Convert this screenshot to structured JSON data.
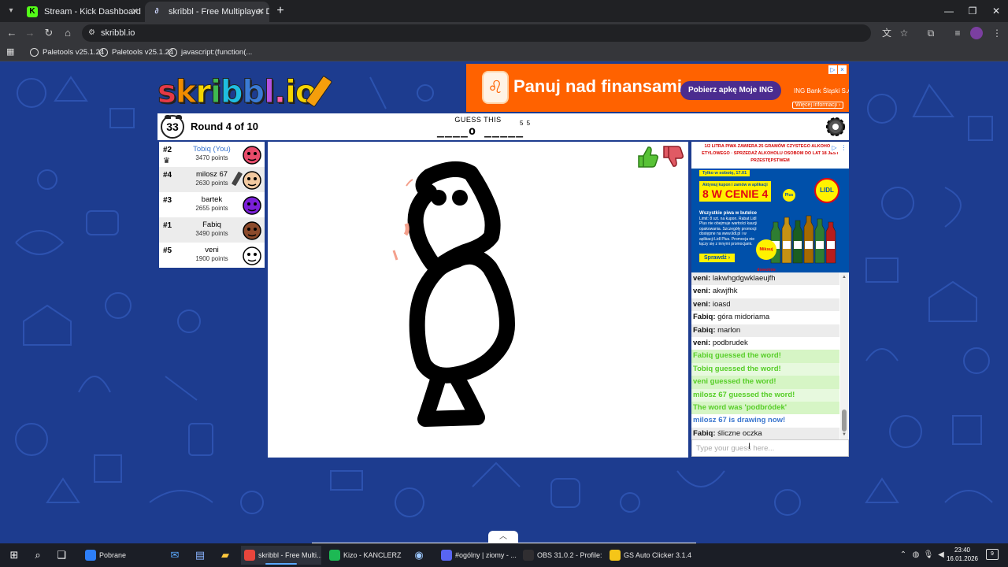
{
  "browser": {
    "tabs": [
      {
        "title": "Stream - Kick Dashboard"
      },
      {
        "title": "skribbl - Free Multiplayer Drawi"
      }
    ],
    "url": "skribbl.io",
    "bookmarks": [
      "Paletools v25.1.24",
      "Paletools v25.1.24",
      "javascript:(function(..."
    ]
  },
  "game": {
    "logo": {
      "s": "s",
      "k": "k",
      "r": "r",
      "i": "i",
      "b1": "b",
      "b2": "b",
      "l": "l",
      "dot": ".",
      "io": "io"
    },
    "timer": "33",
    "round": "Round 4 of 10",
    "guess_label": "GUESS THIS",
    "word_hint": "____o _____",
    "word_lengths": "5 5",
    "players": [
      {
        "rank": "#2",
        "name": "Tobiq (You)",
        "points": "3470 points",
        "is_you": true,
        "crown": true,
        "avatar_color": "#e74c6b"
      },
      {
        "rank": "#4",
        "name": "milosz 67",
        "points": "2630 points",
        "drawing": true,
        "avatar_color": "#f2c9a0"
      },
      {
        "rank": "#3",
        "name": "bartek",
        "points": "2655 points",
        "avatar_color": "#7b1fd8"
      },
      {
        "rank": "#1",
        "name": "Fabiq",
        "points": "3490 points",
        "avatar_color": "#8b4a2b"
      },
      {
        "rank": "#5",
        "name": "veni",
        "points": "1900 points",
        "avatar_color": "#ffffff"
      }
    ]
  },
  "ads": {
    "top": {
      "headline": "Panuj nad finansami",
      "cta": "Pobierz apkę Moje ING",
      "sponsor": "ING Bank Śląski S.A.",
      "more": "Więcej informacji ›"
    },
    "side": {
      "warning": "1/2 LITRA PIWA ZAWIERA 25 GRAMÓW CZYSTEGO ALKOHOLU ETYLOWEGO · SPRZEDAŻ ALKOHOLU OSOBOM DO LAT 18 JEST PRZESTĘPSTWEM",
      "date_badge": "Tylko w sobotę, 17.01",
      "promo_sub": "Aktywuj kupon i zamów w aplikacji",
      "promo_main": "8 W CENIE 4",
      "plus_label": "Plus",
      "lidl_label": "LIDL",
      "desc_title": "Wszystkie piwa w butelce",
      "desc_body": "Limit: 8 szt. na kupon. Rabat Lidl Plus nie obejmuje wartości kaucji opakowania. Szczegóły promocji dostępne na www.lidl.pl i w aplikacji Lidl Plus. Promocja nie łączy się z innymi promocjami.",
      "mix": "Miksuj dowolnie",
      "cta": "Sprawdź ›"
    }
  },
  "chat": {
    "messages": [
      {
        "author": "veni:",
        "text": "lakwhgdgwklaeujfh",
        "type": "normal"
      },
      {
        "author": "veni:",
        "text": "akwjfhk",
        "type": "normal"
      },
      {
        "author": "veni:",
        "text": "ioasd",
        "type": "normal"
      },
      {
        "author": "Fabiq:",
        "text": "góra midoriama",
        "type": "normal"
      },
      {
        "author": "Fabiq:",
        "text": "marlon",
        "type": "normal"
      },
      {
        "author": "veni:",
        "text": "podbrudek",
        "type": "normal"
      },
      {
        "author": "",
        "text": "Fabiq guessed the word!",
        "type": "guessed"
      },
      {
        "author": "",
        "text": "Tobiq guessed the word!",
        "type": "guessed"
      },
      {
        "author": "",
        "text": "veni guessed the word!",
        "type": "guessed"
      },
      {
        "author": "",
        "text": "milosz 67 guessed the word!",
        "type": "guessed"
      },
      {
        "author": "",
        "text": "The word was 'podbródek'",
        "type": "guessed"
      },
      {
        "author": "",
        "text": "milosz 67 is drawing now!",
        "type": "info"
      },
      {
        "author": "Fabiq:",
        "text": "śliczne oczka",
        "type": "normal"
      }
    ],
    "input_placeholder": "Type your guess here..."
  },
  "taskbar": {
    "tasks": [
      {
        "label": "Pobrane",
        "color": "#2d7ff9",
        "active": false
      },
      {
        "label": "skribbl - Free Multi...",
        "color": "#e8453c",
        "active": true
      },
      {
        "label": "Kizo - KANCLERZ",
        "color": "#1db954",
        "active": false
      },
      {
        "label": "#ogólny | ziomy - ...",
        "color": "#5865f2",
        "active": false
      },
      {
        "label": "OBS 31.0.2 - Profile:...",
        "color": "#302e31",
        "active": false
      },
      {
        "label": "GS Auto Clicker 3.1.4",
        "color": "#f5c518",
        "active": false
      }
    ],
    "time": "23:40",
    "date": "16.01.2026"
  },
  "colors": {
    "page_bg": "#1d3c8f",
    "guessed": "#56ce27",
    "info": "#3975ce",
    "ing_orange": "#ff6200"
  }
}
